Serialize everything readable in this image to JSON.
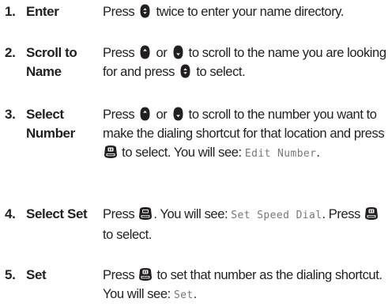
{
  "icons": {
    "select_key": "nav-center-select-icon",
    "scroll_up": "nav-up-icon",
    "scroll_down": "nav-down-icon",
    "clr_key": "clr-key-icon",
    "sto_key": "sto-key-icon"
  },
  "steps": [
    {
      "number": "1.",
      "label": [
        "Enter"
      ],
      "text": [
        "Press ",
        " twice to enter your name directory."
      ]
    },
    {
      "number": "2.",
      "label": [
        "Scroll to",
        "Name"
      ],
      "text": [
        "Press ",
        " or ",
        " to scroll to the name you are looking for and press ",
        " to select."
      ]
    },
    {
      "number": "3.",
      "label": [
        "Select",
        "Number"
      ],
      "text": [
        "Press ",
        " or ",
        " to scroll to the number you want to make the dialing shortcut for that location and press ",
        " to select. You will see: ",
        "Edit Number",
        "."
      ]
    },
    {
      "number": "4.",
      "label": [
        "Select Set"
      ],
      "text": [
        "Press ",
        ". You will see: ",
        "Set Speed Dial",
        ". Press ",
        " to select."
      ]
    },
    {
      "number": "5.",
      "label": [
        "Set"
      ],
      "text": [
        "Press ",
        " to set that number as the dialing shortcut. You will see: ",
        "Set",
        "."
      ]
    }
  ]
}
